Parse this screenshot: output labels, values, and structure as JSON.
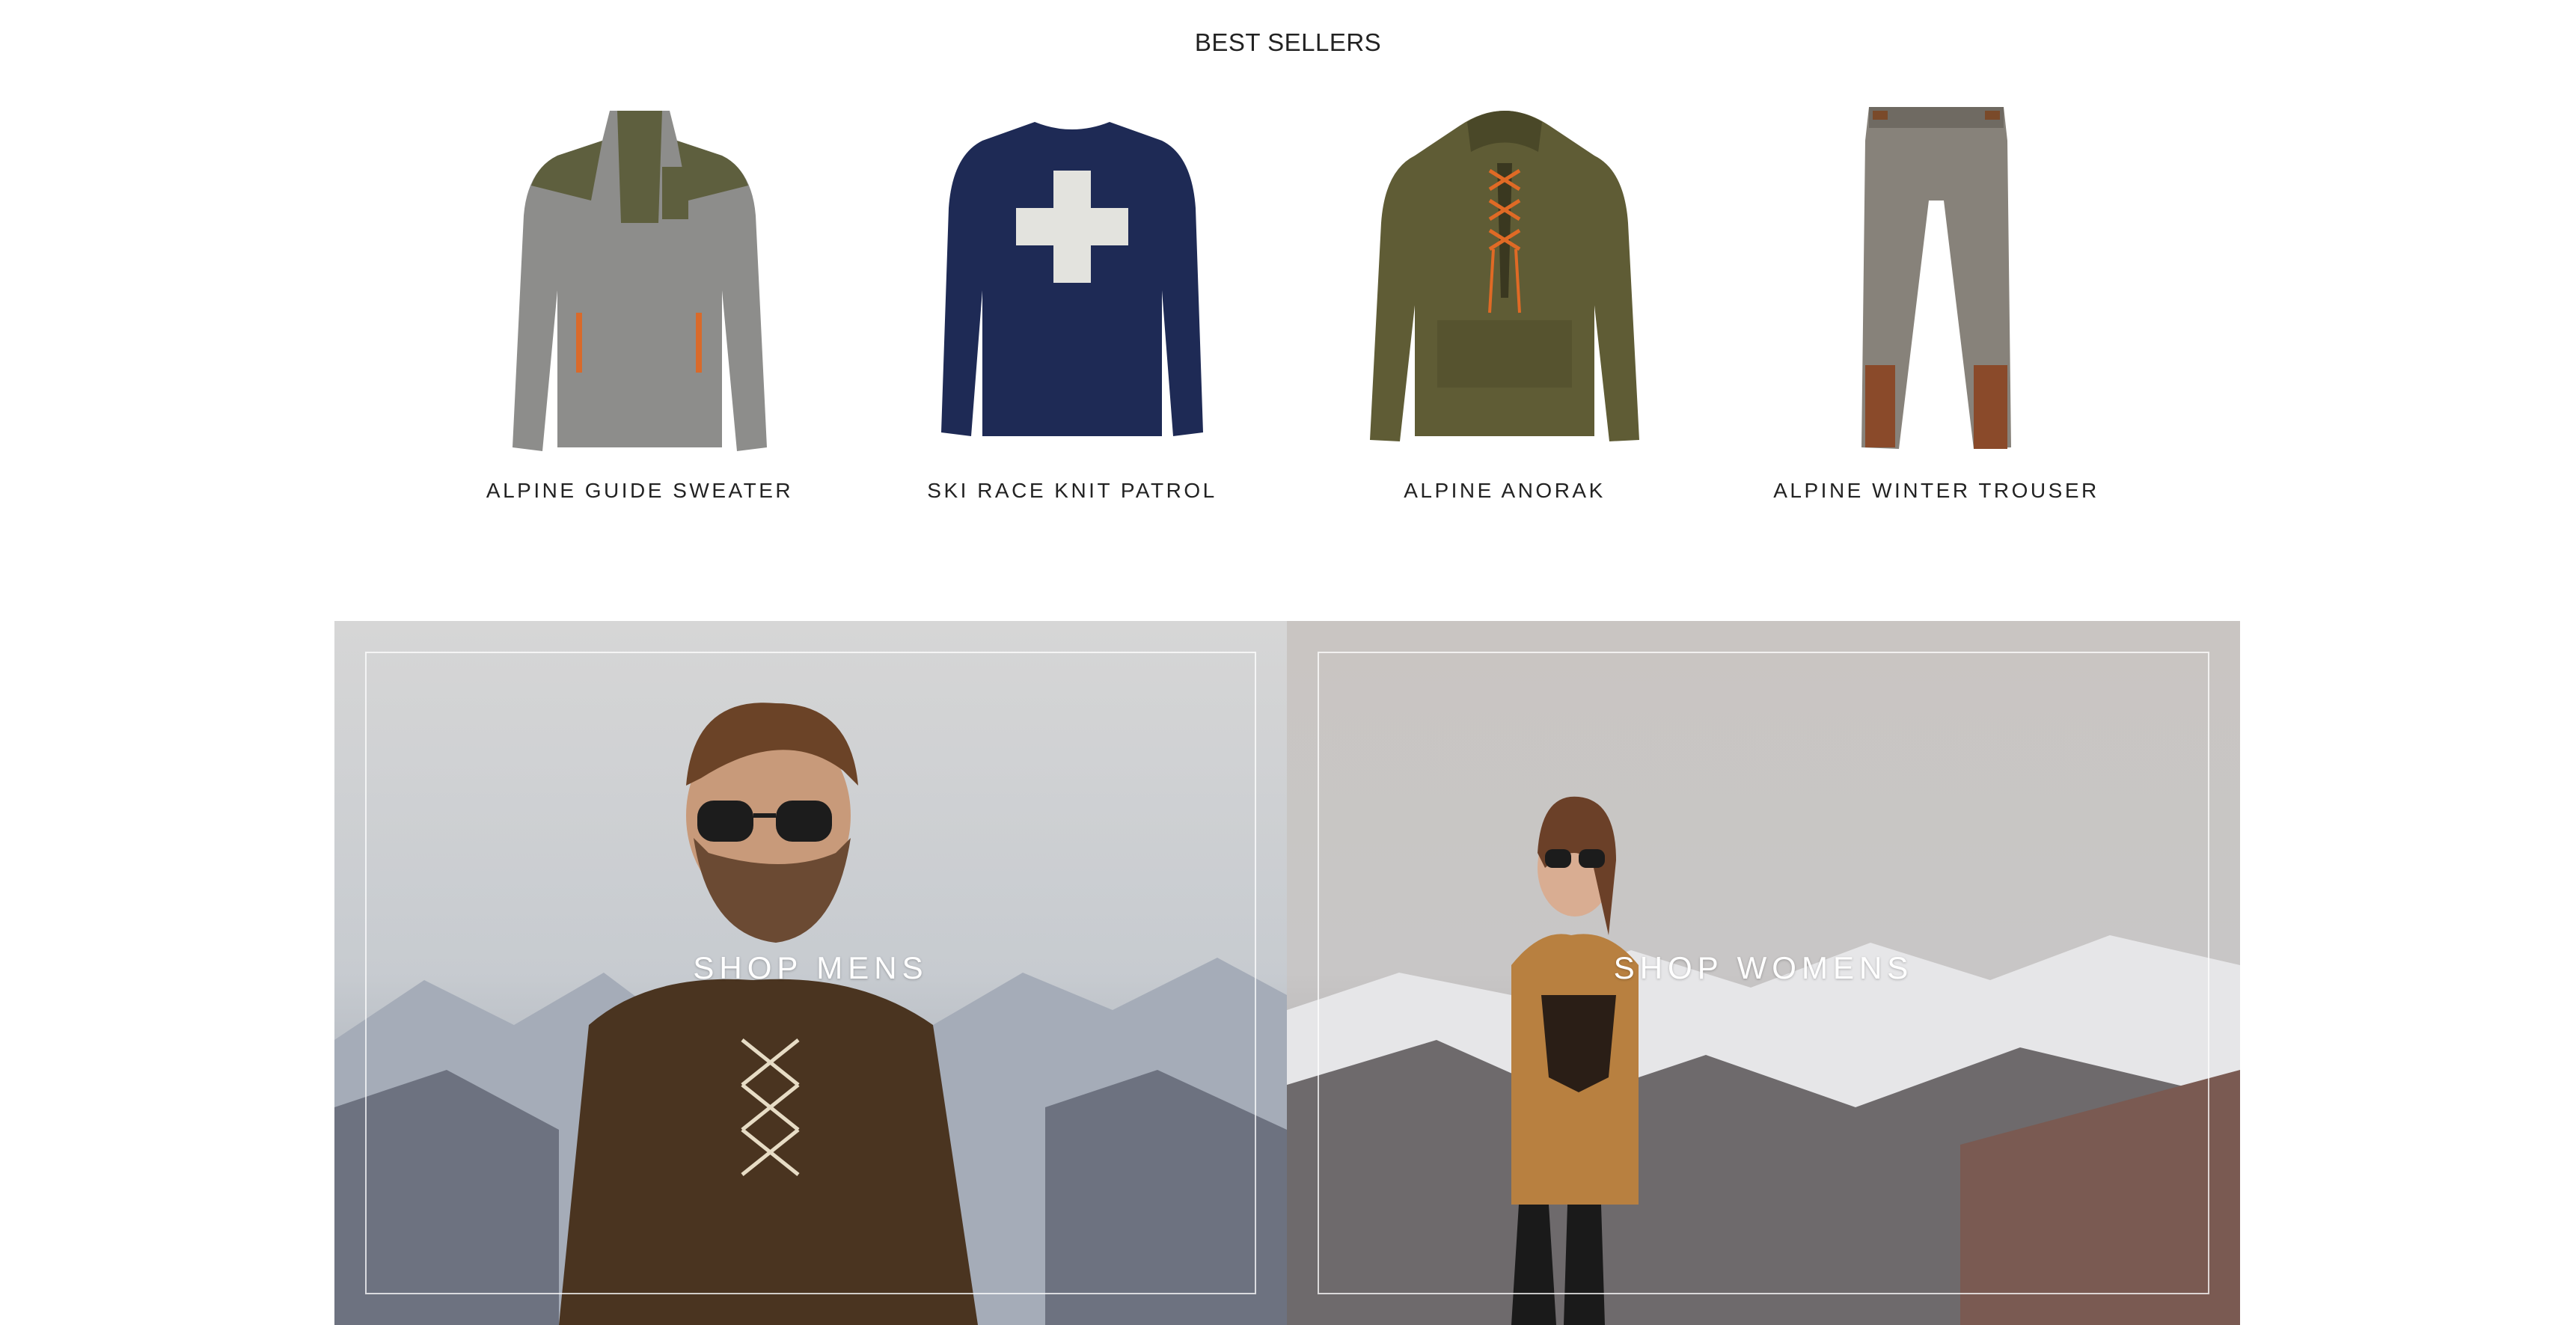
{
  "best_sellers": {
    "title": "BEST SELLERS",
    "products": [
      {
        "name": "ALPINE GUIDE SWEATER",
        "image": "grey-quarter-zip-sweater"
      },
      {
        "name": "SKI RACE KNIT PATROL",
        "image": "navy-cross-sweater"
      },
      {
        "name": "ALPINE ANORAK",
        "image": "olive-lace-up-anorak"
      },
      {
        "name": "ALPINE WINTER TROUSER",
        "image": "tweed-trousers"
      }
    ]
  },
  "promo": {
    "mens": {
      "label": "SHOP MENS",
      "image": "man-in-brown-anorak-mountains"
    },
    "womens": {
      "label": "SHOP WOMENS",
      "image": "woman-in-mustard-sweater-mountains"
    }
  },
  "colors": {
    "text": "#222222",
    "frame": "#ffffff"
  }
}
